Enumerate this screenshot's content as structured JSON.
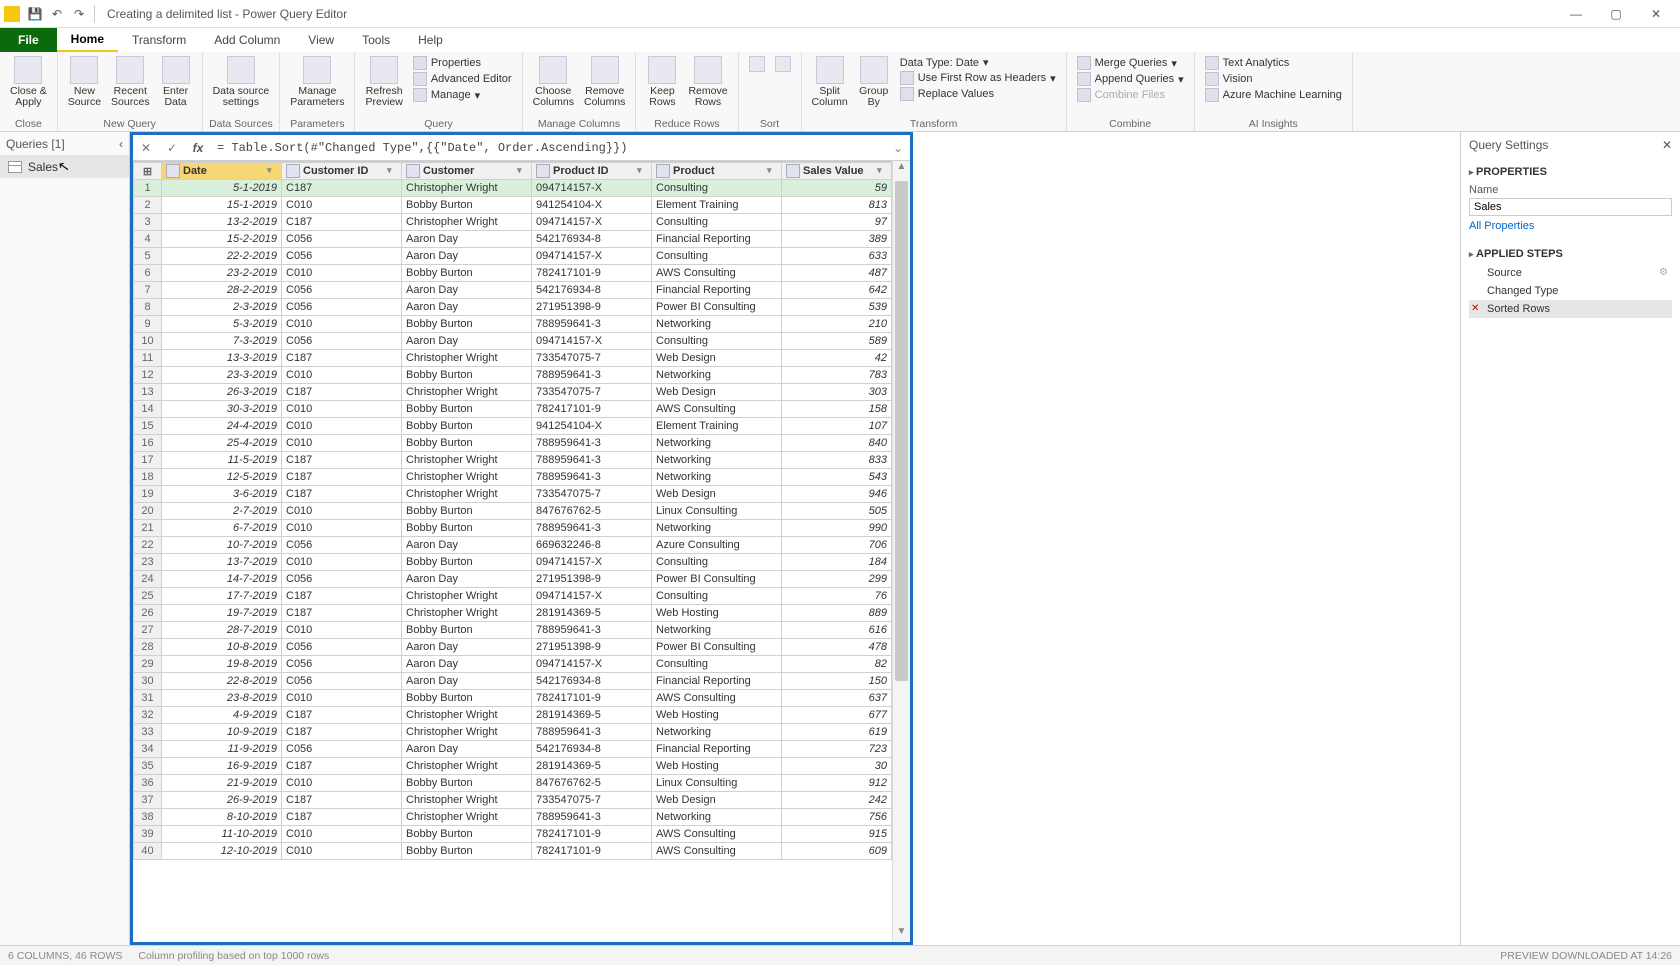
{
  "title": "Creating a delimited list - Power Query Editor",
  "tabs": [
    "File",
    "Home",
    "Transform",
    "Add Column",
    "View",
    "Tools",
    "Help"
  ],
  "ribbon": {
    "close": {
      "close_apply": "Close &\nApply",
      "group": "Close"
    },
    "newquery": {
      "new_source": "New\nSource",
      "recent_sources": "Recent\nSources",
      "enter_data": "Enter\nData",
      "group": "New Query"
    },
    "datasources": {
      "ds_settings": "Data source\nsettings",
      "group": "Data Sources"
    },
    "parameters": {
      "manage_params": "Manage\nParameters",
      "group": "Parameters"
    },
    "query": {
      "refresh": "Refresh\nPreview",
      "properties": "Properties",
      "adv_editor": "Advanced Editor",
      "manage": "Manage",
      "group": "Query"
    },
    "managecols": {
      "choose": "Choose\nColumns",
      "remove": "Remove\nColumns",
      "group": "Manage Columns"
    },
    "reducerows": {
      "keep": "Keep\nRows",
      "removerows": "Remove\nRows",
      "group": "Reduce Rows"
    },
    "sort": {
      "group": "Sort"
    },
    "transform": {
      "split": "Split\nColumn",
      "groupby": "Group\nBy",
      "datatype": "Data Type: Date",
      "firstrow": "Use First Row as Headers",
      "replace": "Replace Values",
      "group": "Transform"
    },
    "combine": {
      "merge": "Merge Queries",
      "append": "Append Queries",
      "combinefiles": "Combine Files",
      "group": "Combine"
    },
    "ai": {
      "text": "Text Analytics",
      "vision": "Vision",
      "ml": "Azure Machine Learning",
      "group": "AI Insights"
    }
  },
  "queries": {
    "title": "Queries [1]",
    "item": "Sales"
  },
  "formula": "= Table.Sort(#\"Changed Type\",{{\"Date\", Order.Ascending}})",
  "columns": [
    "",
    "Date",
    "Customer ID",
    "Customer",
    "Product ID",
    "Product",
    "Sales Value"
  ],
  "rows": [
    [
      "1",
      "5-1-2019",
      "C187",
      "Christopher Wright",
      "094714157-X",
      "Consulting",
      "59"
    ],
    [
      "2",
      "15-1-2019",
      "C010",
      "Bobby Burton",
      "941254104-X",
      "Element Training",
      "813"
    ],
    [
      "3",
      "13-2-2019",
      "C187",
      "Christopher Wright",
      "094714157-X",
      "Consulting",
      "97"
    ],
    [
      "4",
      "15-2-2019",
      "C056",
      "Aaron Day",
      "542176934-8",
      "Financial Reporting",
      "389"
    ],
    [
      "5",
      "22-2-2019",
      "C056",
      "Aaron Day",
      "094714157-X",
      "Consulting",
      "633"
    ],
    [
      "6",
      "23-2-2019",
      "C010",
      "Bobby Burton",
      "782417101-9",
      "AWS Consulting",
      "487"
    ],
    [
      "7",
      "28-2-2019",
      "C056",
      "Aaron Day",
      "542176934-8",
      "Financial Reporting",
      "642"
    ],
    [
      "8",
      "2-3-2019",
      "C056",
      "Aaron Day",
      "271951398-9",
      "Power BI Consulting",
      "539"
    ],
    [
      "9",
      "5-3-2019",
      "C010",
      "Bobby Burton",
      "788959641-3",
      "Networking",
      "210"
    ],
    [
      "10",
      "7-3-2019",
      "C056",
      "Aaron Day",
      "094714157-X",
      "Consulting",
      "589"
    ],
    [
      "11",
      "13-3-2019",
      "C187",
      "Christopher Wright",
      "733547075-7",
      "Web Design",
      "42"
    ],
    [
      "12",
      "23-3-2019",
      "C010",
      "Bobby Burton",
      "788959641-3",
      "Networking",
      "783"
    ],
    [
      "13",
      "26-3-2019",
      "C187",
      "Christopher Wright",
      "733547075-7",
      "Web Design",
      "303"
    ],
    [
      "14",
      "30-3-2019",
      "C010",
      "Bobby Burton",
      "782417101-9",
      "AWS Consulting",
      "158"
    ],
    [
      "15",
      "24-4-2019",
      "C010",
      "Bobby Burton",
      "941254104-X",
      "Element Training",
      "107"
    ],
    [
      "16",
      "25-4-2019",
      "C010",
      "Bobby Burton",
      "788959641-3",
      "Networking",
      "840"
    ],
    [
      "17",
      "11-5-2019",
      "C187",
      "Christopher Wright",
      "788959641-3",
      "Networking",
      "833"
    ],
    [
      "18",
      "12-5-2019",
      "C187",
      "Christopher Wright",
      "788959641-3",
      "Networking",
      "543"
    ],
    [
      "19",
      "3-6-2019",
      "C187",
      "Christopher Wright",
      "733547075-7",
      "Web Design",
      "946"
    ],
    [
      "20",
      "2-7-2019",
      "C010",
      "Bobby Burton",
      "847676762-5",
      "Linux Consulting",
      "505"
    ],
    [
      "21",
      "6-7-2019",
      "C010",
      "Bobby Burton",
      "788959641-3",
      "Networking",
      "990"
    ],
    [
      "22",
      "10-7-2019",
      "C056",
      "Aaron Day",
      "669632246-8",
      "Azure Consulting",
      "706"
    ],
    [
      "23",
      "13-7-2019",
      "C010",
      "Bobby Burton",
      "094714157-X",
      "Consulting",
      "184"
    ],
    [
      "24",
      "14-7-2019",
      "C056",
      "Aaron Day",
      "271951398-9",
      "Power BI Consulting",
      "299"
    ],
    [
      "25",
      "17-7-2019",
      "C187",
      "Christopher Wright",
      "094714157-X",
      "Consulting",
      "76"
    ],
    [
      "26",
      "19-7-2019",
      "C187",
      "Christopher Wright",
      "281914369-5",
      "Web Hosting",
      "889"
    ],
    [
      "27",
      "28-7-2019",
      "C010",
      "Bobby Burton",
      "788959641-3",
      "Networking",
      "616"
    ],
    [
      "28",
      "10-8-2019",
      "C056",
      "Aaron Day",
      "271951398-9",
      "Power BI Consulting",
      "478"
    ],
    [
      "29",
      "19-8-2019",
      "C056",
      "Aaron Day",
      "094714157-X",
      "Consulting",
      "82"
    ],
    [
      "30",
      "22-8-2019",
      "C056",
      "Aaron Day",
      "542176934-8",
      "Financial Reporting",
      "150"
    ],
    [
      "31",
      "23-8-2019",
      "C010",
      "Bobby Burton",
      "782417101-9",
      "AWS Consulting",
      "637"
    ],
    [
      "32",
      "4-9-2019",
      "C187",
      "Christopher Wright",
      "281914369-5",
      "Web Hosting",
      "677"
    ],
    [
      "33",
      "10-9-2019",
      "C187",
      "Christopher Wright",
      "788959641-3",
      "Networking",
      "619"
    ],
    [
      "34",
      "11-9-2019",
      "C056",
      "Aaron Day",
      "542176934-8",
      "Financial Reporting",
      "723"
    ],
    [
      "35",
      "16-9-2019",
      "C187",
      "Christopher Wright",
      "281914369-5",
      "Web Hosting",
      "30"
    ],
    [
      "36",
      "21-9-2019",
      "C010",
      "Bobby Burton",
      "847676762-5",
      "Linux Consulting",
      "912"
    ],
    [
      "37",
      "26-9-2019",
      "C187",
      "Christopher Wright",
      "733547075-7",
      "Web Design",
      "242"
    ],
    [
      "38",
      "8-10-2019",
      "C187",
      "Christopher Wright",
      "788959641-3",
      "Networking",
      "756"
    ],
    [
      "39",
      "11-10-2019",
      "C010",
      "Bobby Burton",
      "782417101-9",
      "AWS Consulting",
      "915"
    ],
    [
      "40",
      "12-10-2019",
      "C010",
      "Bobby Burton",
      "782417101-9",
      "AWS Consulting",
      "609"
    ]
  ],
  "settings": {
    "title": "Query Settings",
    "properties": "PROPERTIES",
    "name_label": "Name",
    "name_value": "Sales",
    "all_props": "All Properties",
    "applied_steps": "APPLIED STEPS",
    "steps": [
      "Source",
      "Changed Type",
      "Sorted Rows"
    ]
  },
  "status": {
    "left1": "6 COLUMNS, 46 ROWS",
    "left2": "Column profiling based on top 1000 rows",
    "right": "PREVIEW DOWNLOADED AT 14:26"
  }
}
